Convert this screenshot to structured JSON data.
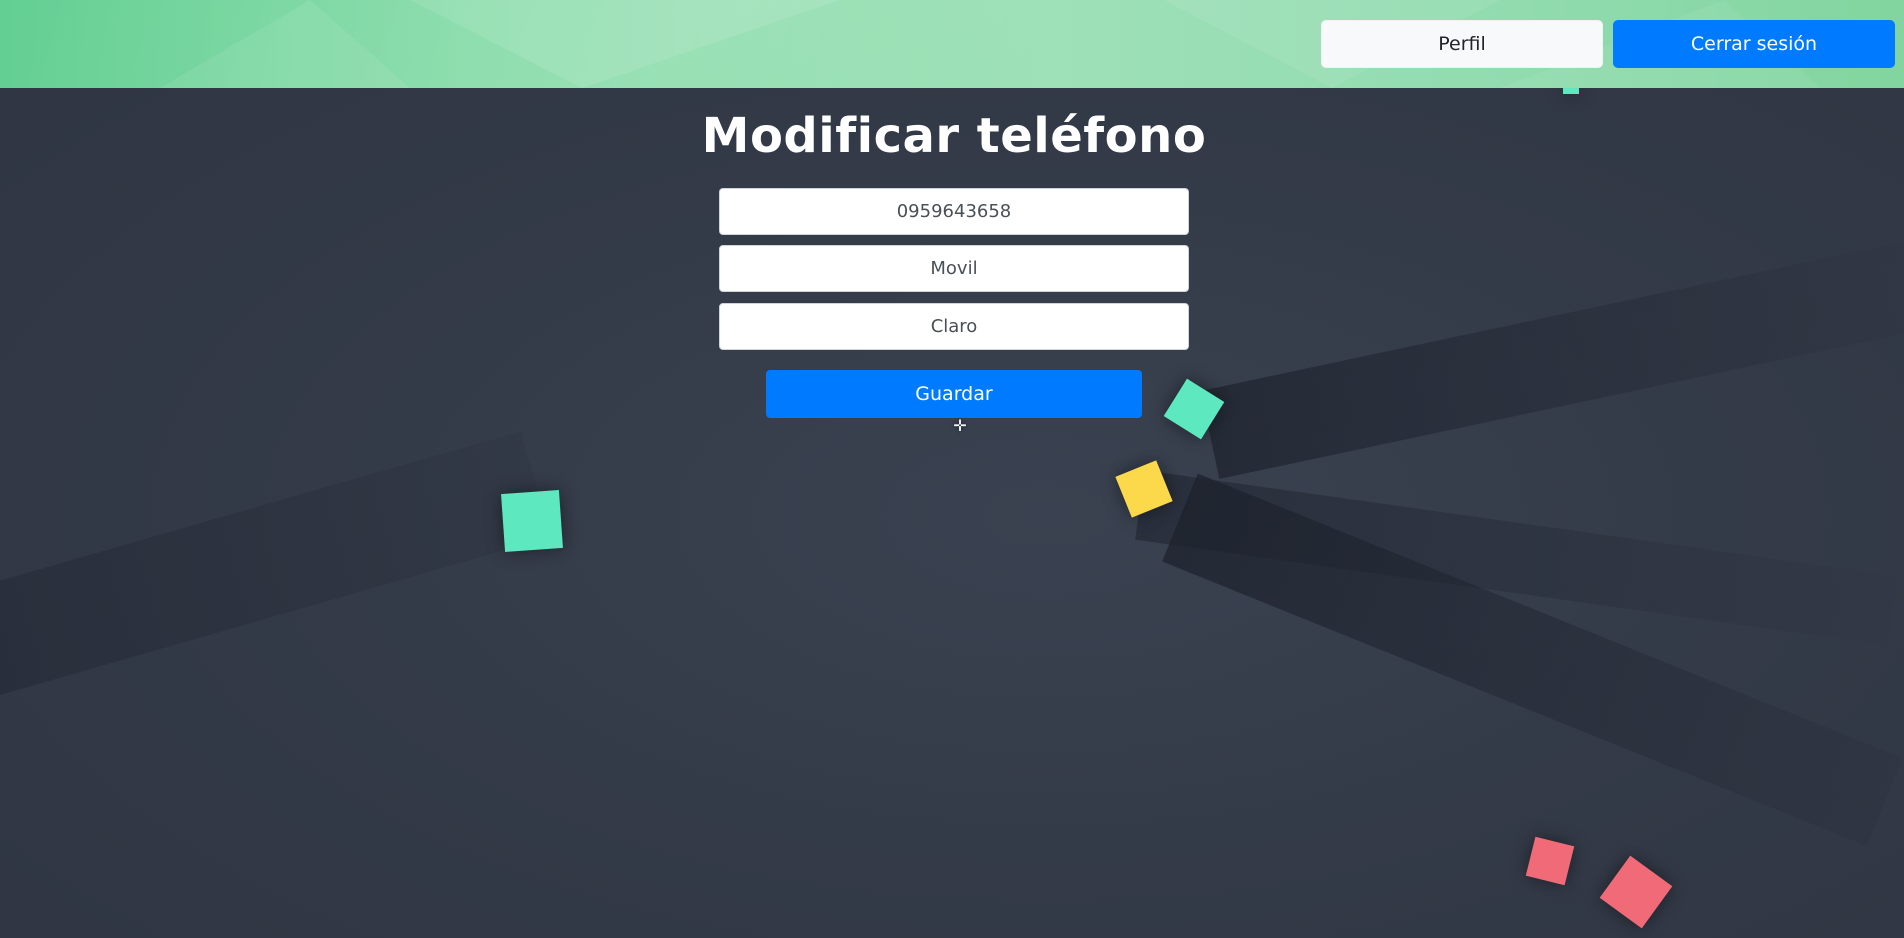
{
  "navbar": {
    "profile_label": "Perfil",
    "logout_label": "Cerrar sesión"
  },
  "form": {
    "title": "Modificar teléfono",
    "phone_value": "0959643658",
    "type_value": "Movil",
    "carrier_value": "Claro",
    "save_label": "Guardar"
  },
  "colors": {
    "primary": "#007bff",
    "navbar_green": "#8fdcae",
    "background": "#353c49",
    "cube_green": "#5ee8bf",
    "cube_yellow": "#fbd94b",
    "cube_red": "#f06b77"
  },
  "icons": {
    "cursor": "move-cursor-icon"
  }
}
